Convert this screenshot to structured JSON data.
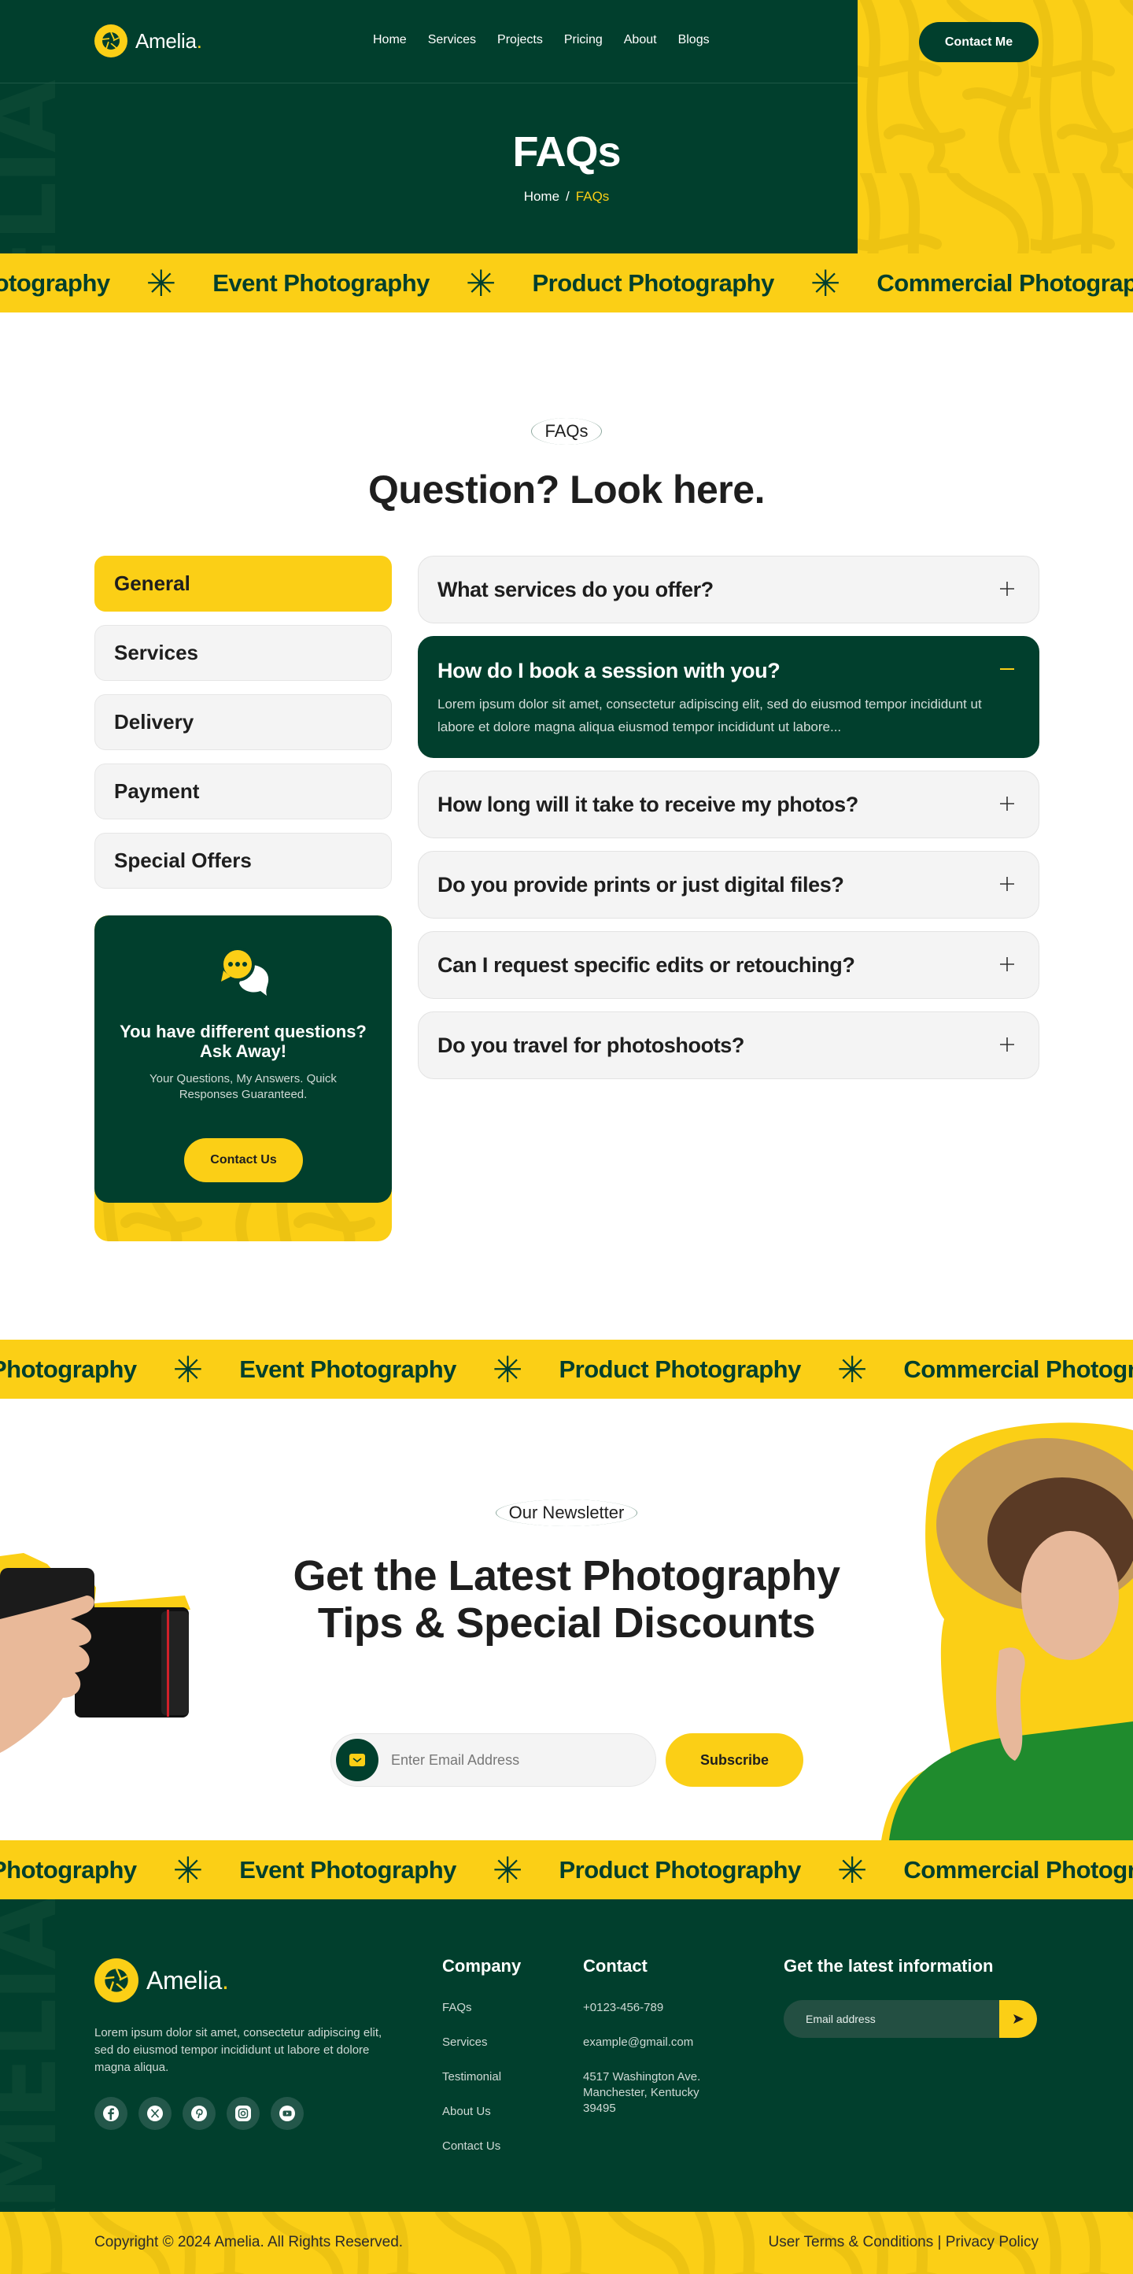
{
  "brand": {
    "name": "Amelia",
    "dot": "."
  },
  "colors": {
    "primary_green": "#013f2d",
    "accent_yellow": "#fbcf16",
    "text_dark": "#1e1e1e",
    "card_grey": "#f4f4f4"
  },
  "nav": {
    "items": [
      "Home",
      "Services",
      "Projects",
      "Pricing",
      "About",
      "Blogs"
    ],
    "cta": "Contact Me"
  },
  "hero": {
    "title": "FAQs",
    "breadcrumb": {
      "home": "Home",
      "separator": "/",
      "current": "FAQs"
    },
    "background_text": "AMELIA"
  },
  "marquee": {
    "items": [
      "Photography",
      "Event Photography",
      "Product Photography",
      "Commercial Photography"
    ],
    "separator_icon": "asterisk-star-icon"
  },
  "faq_section": {
    "label": "FAQs",
    "title": "Question? Look here.",
    "categories": [
      {
        "label": "General",
        "active": true
      },
      {
        "label": "Services",
        "active": false
      },
      {
        "label": "Delivery",
        "active": false
      },
      {
        "label": "Payment",
        "active": false
      },
      {
        "label": "Special Offers",
        "active": false
      }
    ],
    "ask_card": {
      "icon": "chat-bubbles-icon",
      "title": "You have different questions? Ask Away!",
      "subtitle": "Your Questions, My Answers. Quick Responses Guaranteed.",
      "button": "Contact Us"
    },
    "questions": [
      {
        "q": "What services do you offer?",
        "open": false
      },
      {
        "q": "How do I book a session with you?",
        "open": true,
        "a": "Lorem ipsum dolor sit amet, consectetur adipiscing elit, sed do eiusmod tempor incididunt ut labore et dolore magna aliqua eiusmod tempor incididunt ut labore..."
      },
      {
        "q": "How long will it take to receive my photos?",
        "open": false
      },
      {
        "q": "Do you provide prints or just digital files?",
        "open": false
      },
      {
        "q": "Can I request specific edits or retouching?",
        "open": false
      },
      {
        "q": "Do you travel for photoshoots?",
        "open": false
      }
    ]
  },
  "newsletter": {
    "label": "Our Newsletter",
    "title_line1": "Get the Latest Photography",
    "title_line2": "Tips & Special Discounts",
    "input_placeholder": "Enter Email Address",
    "button": "Subscribe"
  },
  "footer": {
    "description": "Lorem ipsum dolor sit amet, consectetur adipiscing elit, sed do eiusmod tempor incididunt ut labore et dolore magna aliqua.",
    "socials": [
      "facebook-icon",
      "x-twitter-icon",
      "pinterest-icon",
      "instagram-icon",
      "youtube-icon"
    ],
    "company": {
      "heading": "Company",
      "links": [
        "FAQs",
        "Services",
        "Testimonial",
        "About Us",
        "Contact Us"
      ]
    },
    "contact": {
      "heading": "Contact",
      "phone": "+0123-456-789",
      "email": "example@gmail.com",
      "address_line1": "4517 Washington Ave.",
      "address_line2": "Manchester, Kentucky",
      "address_line3": "39495"
    },
    "newsletter": {
      "heading": "Get the latest information",
      "placeholder": "Email address"
    },
    "copyright": "Copyright © 2024 Amelia. All Rights Reserved.",
    "terms": "User Terms & Conditions",
    "divider": "|",
    "privacy": "Privacy Policy"
  }
}
